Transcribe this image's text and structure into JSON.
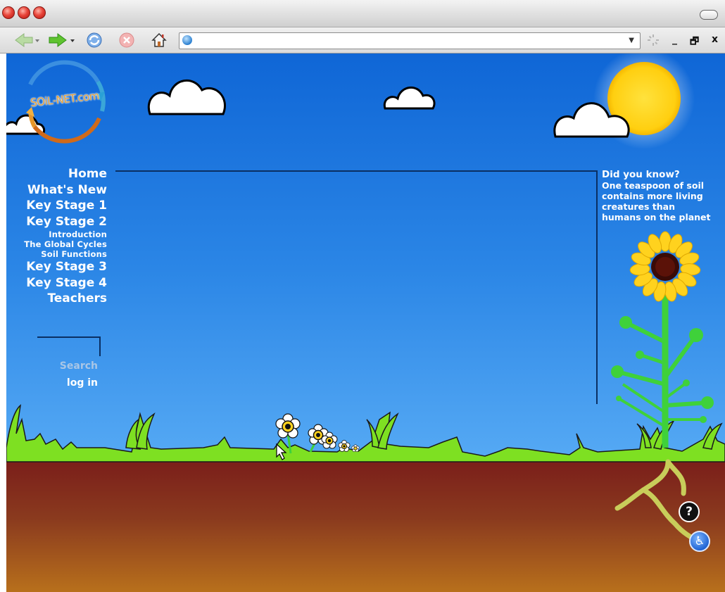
{
  "browser": {
    "window_controls": {
      "minimize": "_",
      "restore": "🗗",
      "close": "x"
    },
    "url": {
      "value": "",
      "dropdown": "▼"
    }
  },
  "logo": {
    "text": "SOiL-NET.com"
  },
  "nav": {
    "items": [
      {
        "label": "Home",
        "size": "big"
      },
      {
        "label": "What's New",
        "size": "big"
      },
      {
        "label": "Key Stage 1",
        "size": "big"
      },
      {
        "label": "Key Stage 2",
        "size": "big"
      },
      {
        "label": "Introduction",
        "size": "small"
      },
      {
        "label": "The Global Cycles",
        "size": "small"
      },
      {
        "label": "Soil Functions",
        "size": "small"
      },
      {
        "label": "Key Stage 3",
        "size": "big"
      },
      {
        "label": "Key Stage 4",
        "size": "big"
      },
      {
        "label": "Teachers",
        "size": "big"
      }
    ]
  },
  "search": {
    "label": "Search"
  },
  "login": {
    "label": "log in"
  },
  "did_you_know": {
    "title": "Did you know?",
    "lines": [
      "One teaspoon of soil",
      "contains more living",
      "creatures than",
      "humans on the planet"
    ]
  },
  "help": {
    "symbol": "?"
  },
  "accessibility": {
    "symbol": "♿"
  },
  "colors": {
    "sky_top": "#0f66d6",
    "sky_bottom": "#63b5f6",
    "grass": "#7ee022",
    "soil_top": "#7a1d1a",
    "soil_bottom": "#b8701c",
    "sun": "#ffd21e"
  }
}
